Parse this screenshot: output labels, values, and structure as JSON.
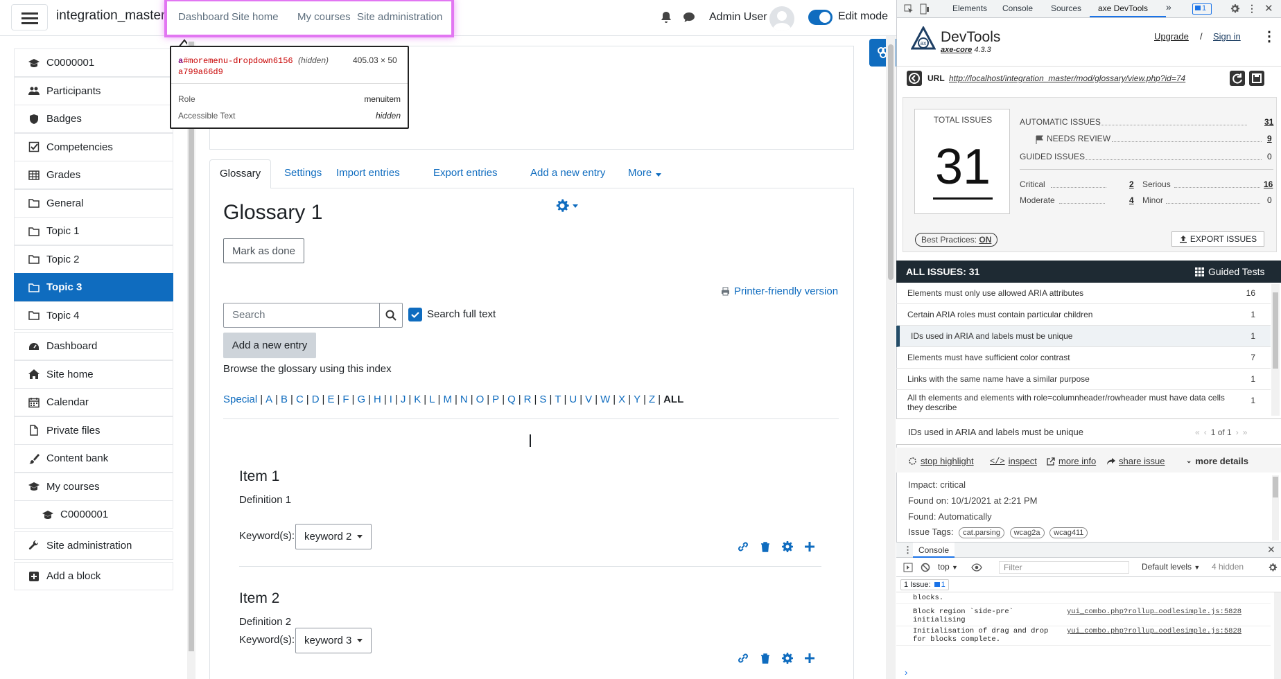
{
  "topnav": {
    "site_name": "integration_master",
    "primary": [
      "Dashboard",
      "Site home",
      "My courses",
      "Site administration"
    ],
    "user_name": "Admin User",
    "edit_mode_label": "Edit mode"
  },
  "tooltip": {
    "selector_tag": "a",
    "selector_id": "#moremenu-dropdown6156a799a66d9",
    "visibility": "(hidden)",
    "size": "405.03 × 50",
    "role_label": "Role",
    "role_value": "menuitem",
    "acc_label": "Accessible Text",
    "acc_value": "hidden"
  },
  "course_index": {
    "items": [
      {
        "label": "C0000001",
        "icon": "graduation-cap-icon"
      },
      {
        "label": "Participants",
        "icon": "users-icon"
      },
      {
        "label": "Badges",
        "icon": "shield-icon"
      },
      {
        "label": "Competencies",
        "icon": "check-square-icon"
      },
      {
        "label": "Grades",
        "icon": "table-icon"
      },
      {
        "label": "General",
        "icon": "folder-icon"
      },
      {
        "label": "Topic 1",
        "icon": "folder-icon"
      },
      {
        "label": "Topic 2",
        "icon": "folder-icon"
      },
      {
        "label": "Topic 3",
        "icon": "folder-icon",
        "active": true
      },
      {
        "label": "Topic 4",
        "icon": "folder-icon"
      },
      {
        "label": "Dashboard",
        "icon": "tachometer-icon"
      },
      {
        "label": "Site home",
        "icon": "home-icon"
      },
      {
        "label": "Calendar",
        "icon": "calendar-icon"
      },
      {
        "label": "Private files",
        "icon": "file-icon"
      },
      {
        "label": "Content bank",
        "icon": "paintbrush-icon"
      },
      {
        "label": "My courses",
        "icon": "graduation-cap-icon"
      },
      {
        "label": "C0000001",
        "icon": "graduation-cap-icon"
      },
      {
        "label": "Site administration",
        "icon": "wrench-icon"
      },
      {
        "label": "Add a block",
        "icon": "plus-square-icon"
      }
    ]
  },
  "tabs": [
    "Glossary",
    "Settings",
    "Import entries",
    "Export entries",
    "Add a new entry",
    "More"
  ],
  "glossary": {
    "title": "Glossary 1",
    "mark_done": "Mark as done",
    "printer": "Printer-friendly version",
    "search_placeholder": "Search",
    "search_full_text": "Search full text",
    "add_entry": "Add a new entry",
    "browse_text": "Browse the glossary using this index",
    "letters": [
      "Special",
      "A",
      "B",
      "C",
      "D",
      "E",
      "F",
      "G",
      "H",
      "I",
      "J",
      "K",
      "L",
      "M",
      "N",
      "O",
      "P",
      "Q",
      "R",
      "S",
      "T",
      "U",
      "V",
      "W",
      "X",
      "Y",
      "Z"
    ],
    "all_label": "ALL",
    "keyword_label": "Keyword(s):",
    "entries": [
      {
        "title": "Item 1",
        "definition": "Definition 1",
        "keyword": "keyword 2"
      },
      {
        "title": "Item 2",
        "definition": "Definition 2",
        "keyword": "keyword 3"
      }
    ]
  },
  "devtools": {
    "tabs": [
      "Elements",
      "Console",
      "Sources",
      "axe DevTools"
    ],
    "issue_badge_count": "1",
    "axe": {
      "title": "DevTools",
      "core": "axe-core",
      "version": "4.3.3",
      "upgrade": "Upgrade",
      "slash": "/",
      "sign_in": "Sign in",
      "url_label": "URL",
      "url": "http://localhost/integration_master/mod/glossary/view.php?id=74",
      "total_label": "TOTAL ISSUES",
      "total": "31",
      "automatic_label": "AUTOMATIC ISSUES",
      "automatic": "31",
      "needs_review_label": "NEEDS REVIEW",
      "needs_review": "9",
      "guided_label": "GUIDED ISSUES",
      "guided": "0",
      "critical_label": "Critical",
      "critical": "2",
      "serious_label": "Serious",
      "serious": "16",
      "moderate_label": "Moderate",
      "moderate": "4",
      "minor_label": "Minor",
      "minor": "0",
      "best_practices": "Best Practices:",
      "best_practices_state": "ON",
      "export": "EXPORT ISSUES",
      "all_issues_label": "ALL ISSUES:",
      "all_issues": "31",
      "guided_tests": "Guided Tests",
      "issues": [
        {
          "label": "Elements must only use allowed ARIA attributes",
          "count": "16"
        },
        {
          "label": "Certain ARIA roles must contain particular children",
          "count": "1"
        },
        {
          "label": "IDs used in ARIA and labels must be unique",
          "count": "1",
          "selected": true
        },
        {
          "label": "Elements must have sufficient color contrast",
          "count": "7"
        },
        {
          "label": "Links with the same name have a similar purpose",
          "count": "1"
        },
        {
          "label": "All th elements and elements with role=columnheader/rowheader must have data cells they describe",
          "count": "1"
        }
      ],
      "selected_issue": "IDs used in ARIA and labels must be unique",
      "pager": "1 of 1",
      "actions": [
        "stop highlight",
        "inspect",
        "more info",
        "share issue",
        "more details"
      ],
      "impact": "Impact: critical",
      "found_on": "Found on: 10/1/2021 at 2:21 PM",
      "found": "Found: Automatically",
      "tags_label": "Issue Tags:",
      "tags": [
        "cat.parsing",
        "wcag2a",
        "wcag411"
      ]
    },
    "console": {
      "title": "Console",
      "context": "top",
      "filter_placeholder": "Filter",
      "levels": "Default levels",
      "hidden": "4 hidden",
      "issue_strip_label": "1 Issue:",
      "issue_strip_count": "1",
      "logs": [
        {
          "text": "blocks.",
          "src": ""
        },
        {
          "text": "Block region `side-pre` initialising",
          "src": "yui_combo.php?rollup…oodlesimple.js:5828"
        },
        {
          "text": "Initialisation of drag and drop for blocks complete.",
          "src": "yui_combo.php?rollup…oodlesimple.js:5828"
        }
      ],
      "prompt": "›"
    }
  }
}
